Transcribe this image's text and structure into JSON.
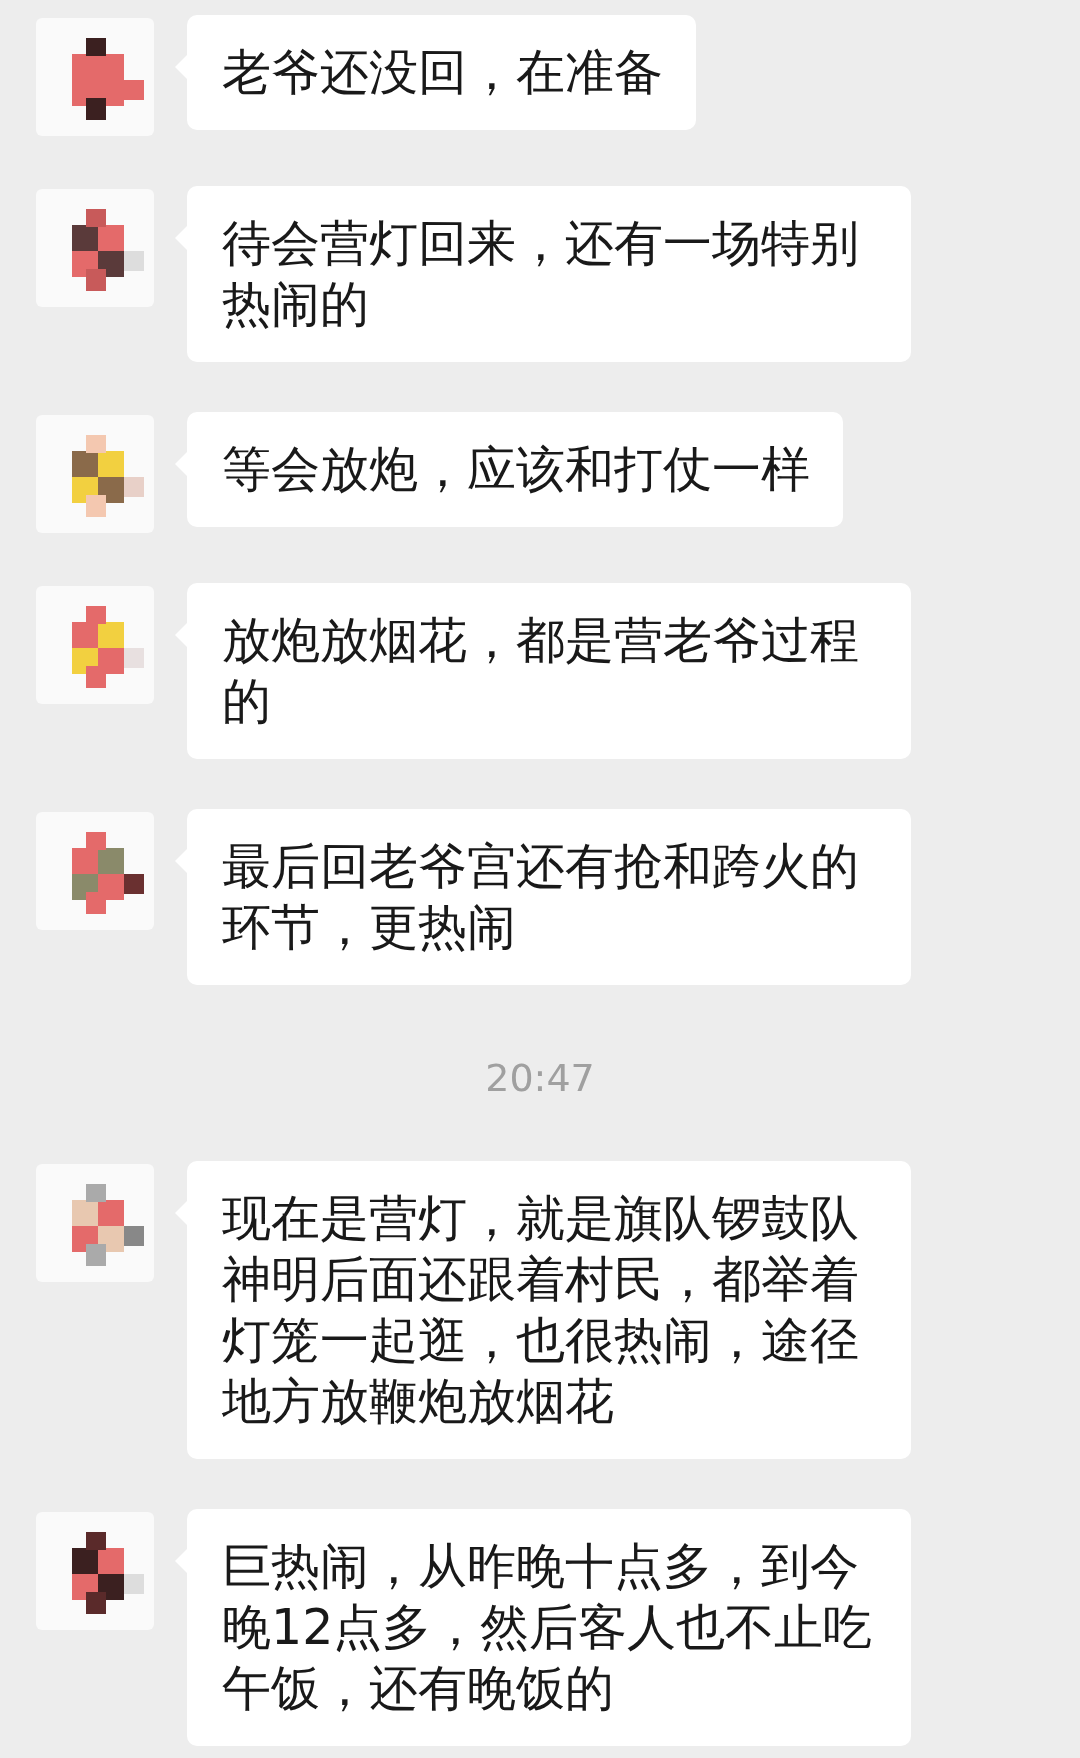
{
  "chat": [
    {
      "kind": "message",
      "text": "老爷还没回，在准备"
    },
    {
      "kind": "message",
      "text": "待会营灯回来，还有一场特别热闹的"
    },
    {
      "kind": "message",
      "text": "等会放炮，应该和打仗一样"
    },
    {
      "kind": "message",
      "text": "放炮放烟花，都是营老爷过程的"
    },
    {
      "kind": "message",
      "text": "最后回老爷宫还有抢和跨火的环节，更热闹"
    },
    {
      "kind": "timestamp",
      "text": "20:47"
    },
    {
      "kind": "message",
      "text": "现在是营灯，就是旗队锣鼓队神明后面还跟着村民，都举着灯笼一起逛，也很热闹，途径地方放鞭炮放烟花"
    },
    {
      "kind": "message",
      "text": "巨热闹，从昨晚十点多，到今晚12点多，然后客人也不止吃午饭，还有晚饭的"
    }
  ]
}
